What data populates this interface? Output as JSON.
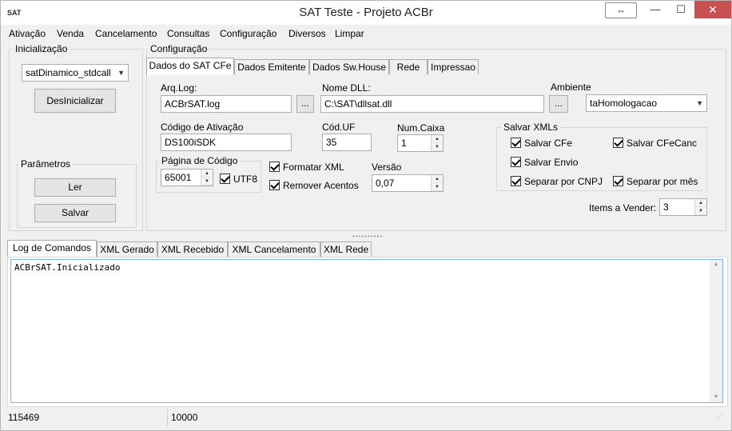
{
  "window": {
    "title": "SAT Teste - Projeto ACBr",
    "icon_text": "SAT",
    "restore_symbol": "⇔",
    "min_symbol": "—",
    "max_symbol": "☐",
    "close_symbol": "✕"
  },
  "menu": [
    "Ativação",
    "Venda",
    "Cancelamento",
    "Consultas",
    "Configuração",
    "Diversos",
    "Limpar"
  ],
  "inicializacao": {
    "label": "Inicialização",
    "combo_value": "satDinamico_stdcall",
    "desinicializar_label": "DesInicializar"
  },
  "parametros": {
    "label": "Parâmetros",
    "ler_label": "Ler",
    "salvar_label": "Salvar"
  },
  "configuracao": {
    "label": "Configuração",
    "tabs": [
      "Dados do SAT CFe",
      "Dados Emitente",
      "Dados Sw.House",
      "Rede",
      "Impressao"
    ],
    "arq_log_label": "Arq.Log:",
    "arq_log_value": "ACBrSAT.log",
    "browse_label": "...",
    "nome_dll_label": "Nome DLL:",
    "nome_dll_value": "C:\\SAT\\dllsat.dll",
    "ambiente_label": "Ambiente",
    "ambiente_value": "taHomologacao",
    "codigo_ativacao_label": "Código de Ativação",
    "codigo_ativacao_value": "DS100iSDK",
    "cod_uf_label": "Cód.UF",
    "cod_uf_value": "35",
    "num_caixa_label": "Num.Caixa",
    "num_caixa_value": "1",
    "pagina_codigo_label": "Página de Código",
    "pagina_codigo_value": "65001",
    "utf8_label": "UTF8",
    "formatar_xml_label": "Formatar XML",
    "remover_acentos_label": "Remover Acentos",
    "versao_label": "Versão",
    "versao_value": "0,07",
    "salvar_xmls_label": "Salvar XMLs",
    "salvar_cfe_label": "Salvar CFe",
    "salvar_cfecanc_label": "Salvar CFeCanc",
    "salvar_envio_label": "Salvar Envio",
    "separar_cnpj_label": "Separar por CNPJ",
    "separar_mes_label": "Separar por mês",
    "items_vender_label": "Items a Vender:",
    "items_vender_value": "3"
  },
  "log": {
    "tabs": [
      "Log de Comandos",
      "XML Gerado",
      "XML Recebido",
      "XML Cancelamento",
      "XML Rede"
    ],
    "content": "ACBrSAT.Inicializado"
  },
  "status": {
    "cell1": "115469",
    "cell2": "10000"
  },
  "colors": {
    "close_button": "#c75050",
    "memo_border": "#7eb4ea"
  }
}
